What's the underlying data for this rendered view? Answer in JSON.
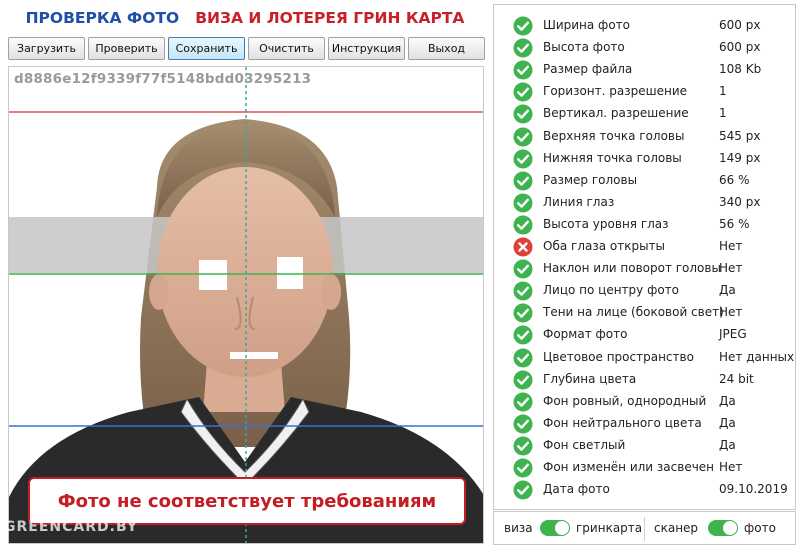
{
  "header": {
    "title_left": "ПРОВЕРКА ФОТО",
    "title_right": "ВИЗА И ЛОТЕРЕЯ ГРИН КАРТА"
  },
  "toolbar": {
    "buttons": [
      {
        "label": "Загрузить",
        "active": false
      },
      {
        "label": "Проверить",
        "active": false
      },
      {
        "label": "Сохранить",
        "active": true
      },
      {
        "label": "Очистить",
        "active": false
      },
      {
        "label": "Инструкция",
        "active": false
      },
      {
        "label": "Выход",
        "active": false
      }
    ]
  },
  "photo": {
    "hash": "d8886e12f9339f77f5148bdd03295213",
    "verdict": "Фото не соответствует требованиям",
    "watermark": "GREENCARD.BY"
  },
  "checks": [
    {
      "label": "Ширина фото",
      "value": "600 px",
      "status": "ok"
    },
    {
      "label": "Высота фото",
      "value": "600 px",
      "status": "ok"
    },
    {
      "label": "Размер файла",
      "value": "108 Kb",
      "status": "ok"
    },
    {
      "label": "Горизонт. разрешение",
      "value": "1",
      "status": "ok"
    },
    {
      "label": "Вертикал. разрешение",
      "value": "1",
      "status": "ok"
    },
    {
      "label": "Верхняя точка головы",
      "value": "545 px",
      "status": "ok"
    },
    {
      "label": "Нижняя точка головы",
      "value": "149 px",
      "status": "ok"
    },
    {
      "label": "Размер головы",
      "value": "66 %",
      "status": "ok"
    },
    {
      "label": "Линия глаз",
      "value": "340 px",
      "status": "ok"
    },
    {
      "label": "Высота уровня глаз",
      "value": "56 %",
      "status": "ok"
    },
    {
      "label": "Оба глаза открыты",
      "value": "Нет",
      "status": "fail"
    },
    {
      "label": "Наклон или поворот головы",
      "value": "Нет",
      "status": "ok"
    },
    {
      "label": "Лицо по центру фото",
      "value": "Да",
      "status": "ok"
    },
    {
      "label": "Тени на лице (боковой свет)",
      "value": "Нет",
      "status": "ok"
    },
    {
      "label": "Формат фото",
      "value": "JPEG",
      "status": "ok"
    },
    {
      "label": "Цветовое пространство",
      "value": "Нет данных",
      "status": "ok"
    },
    {
      "label": "Глубина цвета",
      "value": "24 bit",
      "status": "ok"
    },
    {
      "label": "Фон ровный, однородный",
      "value": "Да",
      "status": "ok"
    },
    {
      "label": "Фон нейтрального цвета",
      "value": "Да",
      "status": "ok"
    },
    {
      "label": "Фон светлый",
      "value": "Да",
      "status": "ok"
    },
    {
      "label": "Фон изменён или засвечен",
      "value": "Нет",
      "status": "ok"
    },
    {
      "label": "Дата фото",
      "value": "09.10.2019",
      "status": "ok"
    }
  ],
  "toggles": {
    "mode": {
      "left_label": "виза",
      "right_label": "гринкарта",
      "on": true
    },
    "source": {
      "left_label": "сканер",
      "right_label": "фото",
      "on": true
    }
  },
  "colors": {
    "title_left": "#1f4fa8",
    "title_right": "#c8202a",
    "ok": "#3fb34f",
    "fail": "#e0403a",
    "verdict": "#c41d24",
    "toggle_on": "#3fb34f",
    "guide_top": "#d9525a",
    "guide_eye": "#3fb34f",
    "guide_chin": "#3a6fd8",
    "guide_center": "#3aa7a7",
    "eye_band": "#c6c6c6"
  },
  "icons": {
    "ok": "check-circle-icon",
    "fail": "x-circle-icon"
  }
}
